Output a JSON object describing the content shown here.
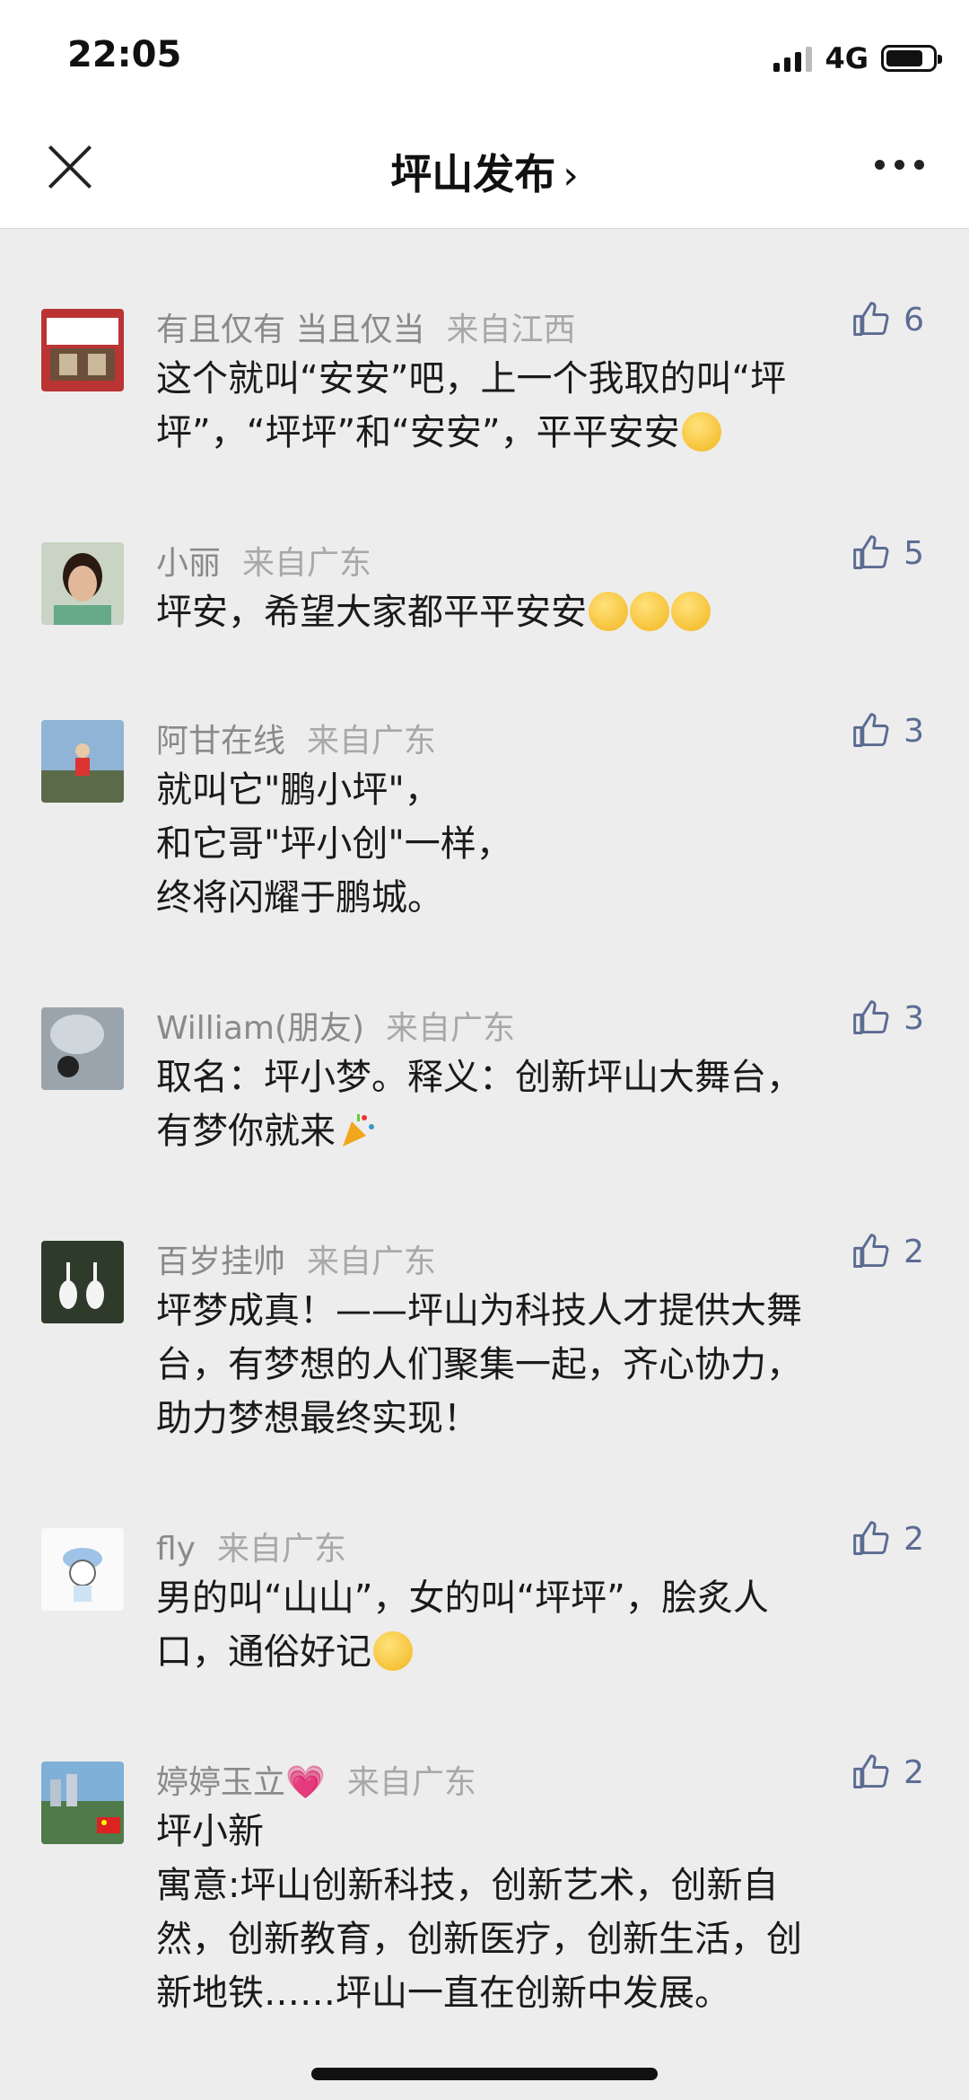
{
  "status": {
    "time": "22:05",
    "network": "4G"
  },
  "header": {
    "title": "坪山发布",
    "chevron": "›"
  },
  "comments": [
    {
      "name": "有且仅有 当且仅当",
      "from": "来自江西",
      "likes": "6",
      "text": "这个就叫“安安”吧，上一个我取的叫“坪\n坪”，“坪坪”和“安安”，平平安安",
      "emoji": "smirk-face"
    },
    {
      "name": "小丽",
      "from": "来自广东",
      "likes": "5",
      "text": "坪安，希望大家都平平安安",
      "emoji": "thinking-face x3"
    },
    {
      "name": "阿甘在线",
      "from": "来自广东",
      "likes": "3",
      "text": "就叫它\"鹏小坪\"，\n和它哥\"坪小创\"一样，\n终将闪耀于鹏城。"
    },
    {
      "name": "William(朋友)",
      "from": "来自广东",
      "likes": "3",
      "text": "取名：坪小梦。释义：创新坪山大舞台，\n有梦你就来",
      "emoji": "party-popper"
    },
    {
      "name": "百岁挂帅",
      "from": "来自广东",
      "likes": "2",
      "text": "坪梦成真！——坪山为科技人才提供大舞\n台，有梦想的人们聚集一起，齐心协力，\n助力梦想最终实现！"
    },
    {
      "name": "fly",
      "from": "来自广东",
      "likes": "2",
      "text": "男的叫“山山”，女的叫“坪坪”，脍炙人\n口，通俗好记",
      "emoji": "shush-face"
    },
    {
      "name": "婷婷玉立💗",
      "from": "来自广东",
      "likes": "2",
      "text": "坪小新\n寓意:坪山创新科技，创新艺术，创新自\n然，创新教育，创新医疗，创新生活，创\n新地铁……坪山一直在创新中发展。"
    }
  ],
  "colors": {
    "like": "#5b6b93",
    "name": "#8a8a8a",
    "background": "#ededed"
  }
}
